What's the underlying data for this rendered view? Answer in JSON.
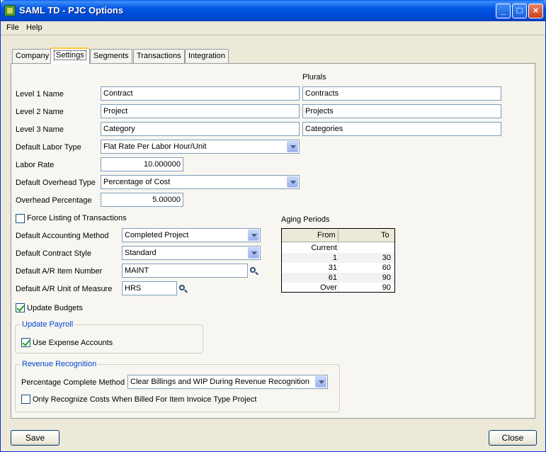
{
  "window": {
    "title": "SAML TD - PJC Options"
  },
  "menu": {
    "file": "File",
    "help": "Help"
  },
  "tabs": [
    "Company",
    "Settings",
    "Segments",
    "Transactions",
    "Integration"
  ],
  "plurals_header": "Plurals",
  "levels": [
    {
      "label": "Level 1 Name",
      "value": "Contract",
      "plural": "Contracts"
    },
    {
      "label": "Level 2 Name",
      "value": "Project",
      "plural": "Projects"
    },
    {
      "label": "Level 3 Name",
      "value": "Category",
      "plural": "Categories"
    }
  ],
  "labor": {
    "type_label": "Default Labor Type",
    "type_value": "Flat Rate Per Labor Hour/Unit",
    "rate_label": "Labor Rate",
    "rate_value": "10.000000"
  },
  "overhead": {
    "type_label": "Default Overhead Type",
    "type_value": "Percentage of Cost",
    "pct_label": "Overhead Percentage",
    "pct_value": "5.00000"
  },
  "force_listing": {
    "label": "Force Listing of Transactions",
    "checked": false
  },
  "accounting": {
    "label": "Default Accounting Method",
    "value": "Completed Project"
  },
  "contract_style": {
    "label": "Default Contract Style",
    "value": "Standard"
  },
  "ar_item": {
    "label": "Default A/R Item Number",
    "value": "MAINT"
  },
  "ar_uom": {
    "label": "Default A/R Unit of Measure",
    "value": "HRS"
  },
  "update_budgets": {
    "label": "Update Budgets",
    "checked": true
  },
  "update_payroll": {
    "title": "Update Payroll",
    "use_expense": {
      "label": "Use Expense Accounts",
      "checked": true
    }
  },
  "revenue": {
    "title": "Revenue Recognition",
    "method_label": "Percentage Complete Method",
    "method_value": "Clear Billings and WIP During Revenue Recognition",
    "only_recognize": {
      "label": "Only Recognize Costs When Billed For Item Invoice Type Project",
      "checked": false
    }
  },
  "aging": {
    "title": "Aging Periods",
    "headers": {
      "from": "From",
      "to": "To"
    },
    "rows": [
      {
        "from": "Current",
        "to": ""
      },
      {
        "from": "1",
        "to": "30"
      },
      {
        "from": "31",
        "to": "60"
      },
      {
        "from": "61",
        "to": "90"
      },
      {
        "from": "Over",
        "to": "90"
      }
    ]
  },
  "buttons": {
    "save": "Save",
    "close": "Close"
  }
}
